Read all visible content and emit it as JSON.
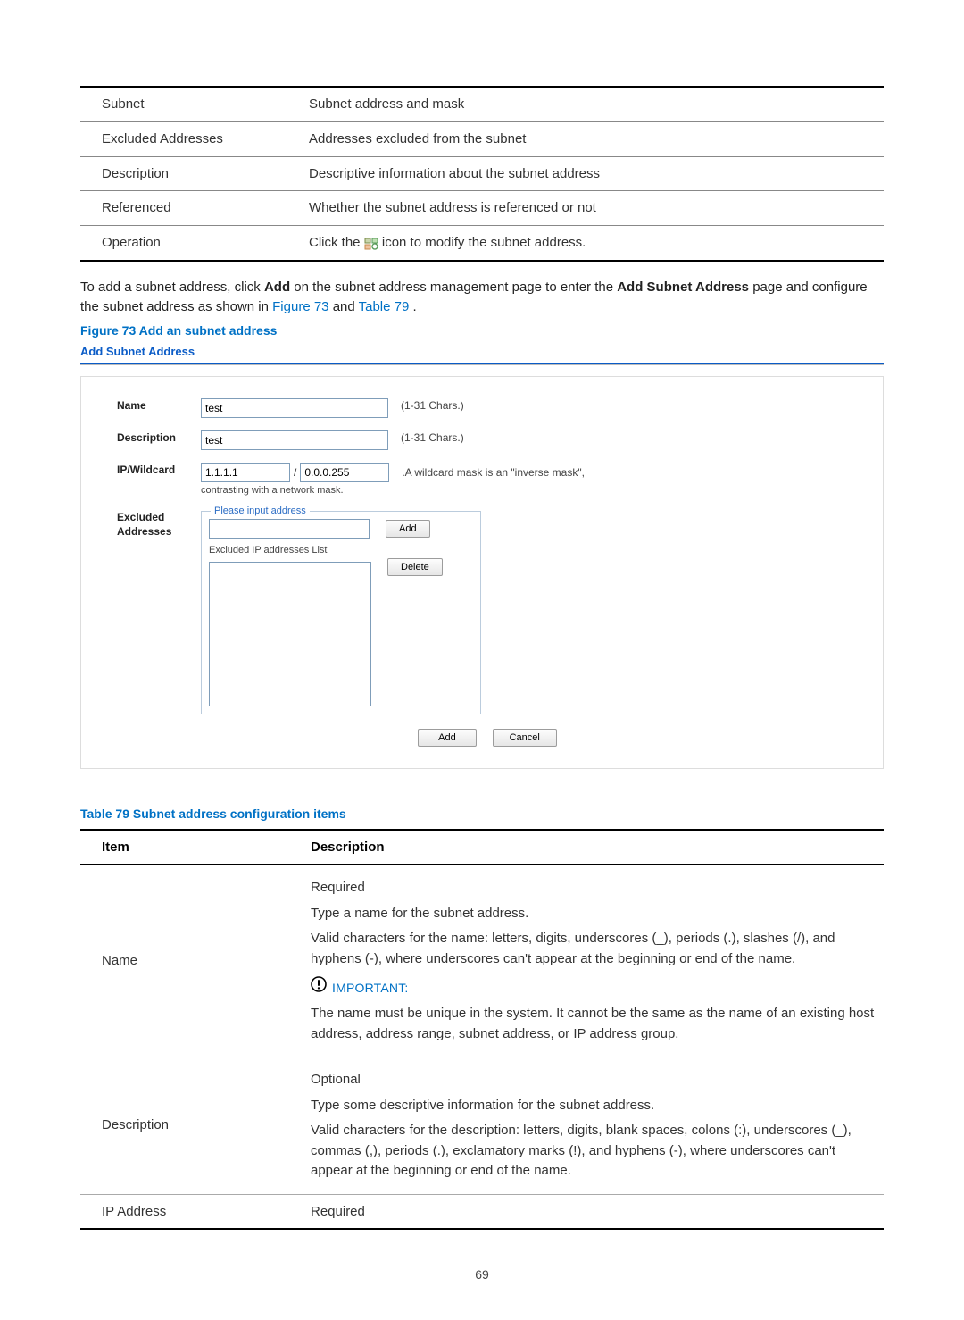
{
  "top_table": {
    "rows": [
      {
        "item": "Subnet",
        "desc": "Subnet address and mask"
      },
      {
        "item": "Excluded Addresses",
        "desc": "Addresses excluded from the subnet"
      },
      {
        "item": "Description",
        "desc": "Descriptive information about the subnet address"
      },
      {
        "item": "Referenced",
        "desc": "Whether the subnet address is referenced or not"
      },
      {
        "item": "Operation",
        "desc_before": "Click the ",
        "desc_after": " icon to modify the subnet address."
      }
    ]
  },
  "body": {
    "p1_a": "To add a subnet address, click ",
    "p1_bold1": "Add",
    "p1_b": " on the subnet address management page to enter the ",
    "p1_bold2": "Add Subnet Address",
    "p1_c": " page and configure the subnet address as shown in ",
    "link1": "Figure 73",
    "p1_d": " and ",
    "link2": "Table 79",
    "p1_e": "."
  },
  "figure_caption": "Figure 73 Add an subnet address",
  "screenshot": {
    "title": "Add Subnet Address",
    "name_label": "Name",
    "name_value": "test",
    "name_hint": "(1-31 Chars.)",
    "desc_label": "Description",
    "desc_value": "test",
    "desc_hint": "(1-31 Chars.)",
    "ipw_label": "IP/Wildcard",
    "ip_value": "1.1.1.1",
    "slash": "/",
    "mask_value": "0.0.0.255",
    "ipw_hint": ".A wildcard mask is an \"inverse mask\",",
    "ipw_sub": "contrasting with a network mask.",
    "exc_label": "Excluded Addresses",
    "legend": "Please input address",
    "add_btn": "Add",
    "exlist_label": "Excluded IP addresses List",
    "del_btn": "Delete",
    "main_add": "Add",
    "main_cancel": "Cancel"
  },
  "table_caption": "Table 79 Subnet address configuration items",
  "cfg_table": {
    "h1": "Item",
    "h2": "Description",
    "name_item": "Name",
    "name_p1": "Required",
    "name_p2": "Type a name for the subnet address.",
    "name_p3": "Valid characters for the name: letters, digits, underscores (_), periods (.), slashes (/), and hyphens (-), where underscores can't appear at the beginning or end of the name.",
    "important_label": "IMPORTANT:",
    "name_p4": "The name must be unique in the system. It cannot be the same as the name of an existing host address, address range, subnet address, or IP address group.",
    "desc_item": "Description",
    "desc_p1": "Optional",
    "desc_p2": "Type some descriptive information for the subnet address.",
    "desc_p3": "Valid characters for the description: letters, digits, blank spaces, colons (:), underscores (_), commas (,), periods (.), exclamatory marks (!), and hyphens (-), where underscores can't appear at the beginning or end of the name.",
    "ip_item": "IP Address",
    "ip_p1": "Required"
  },
  "page_number": "69"
}
